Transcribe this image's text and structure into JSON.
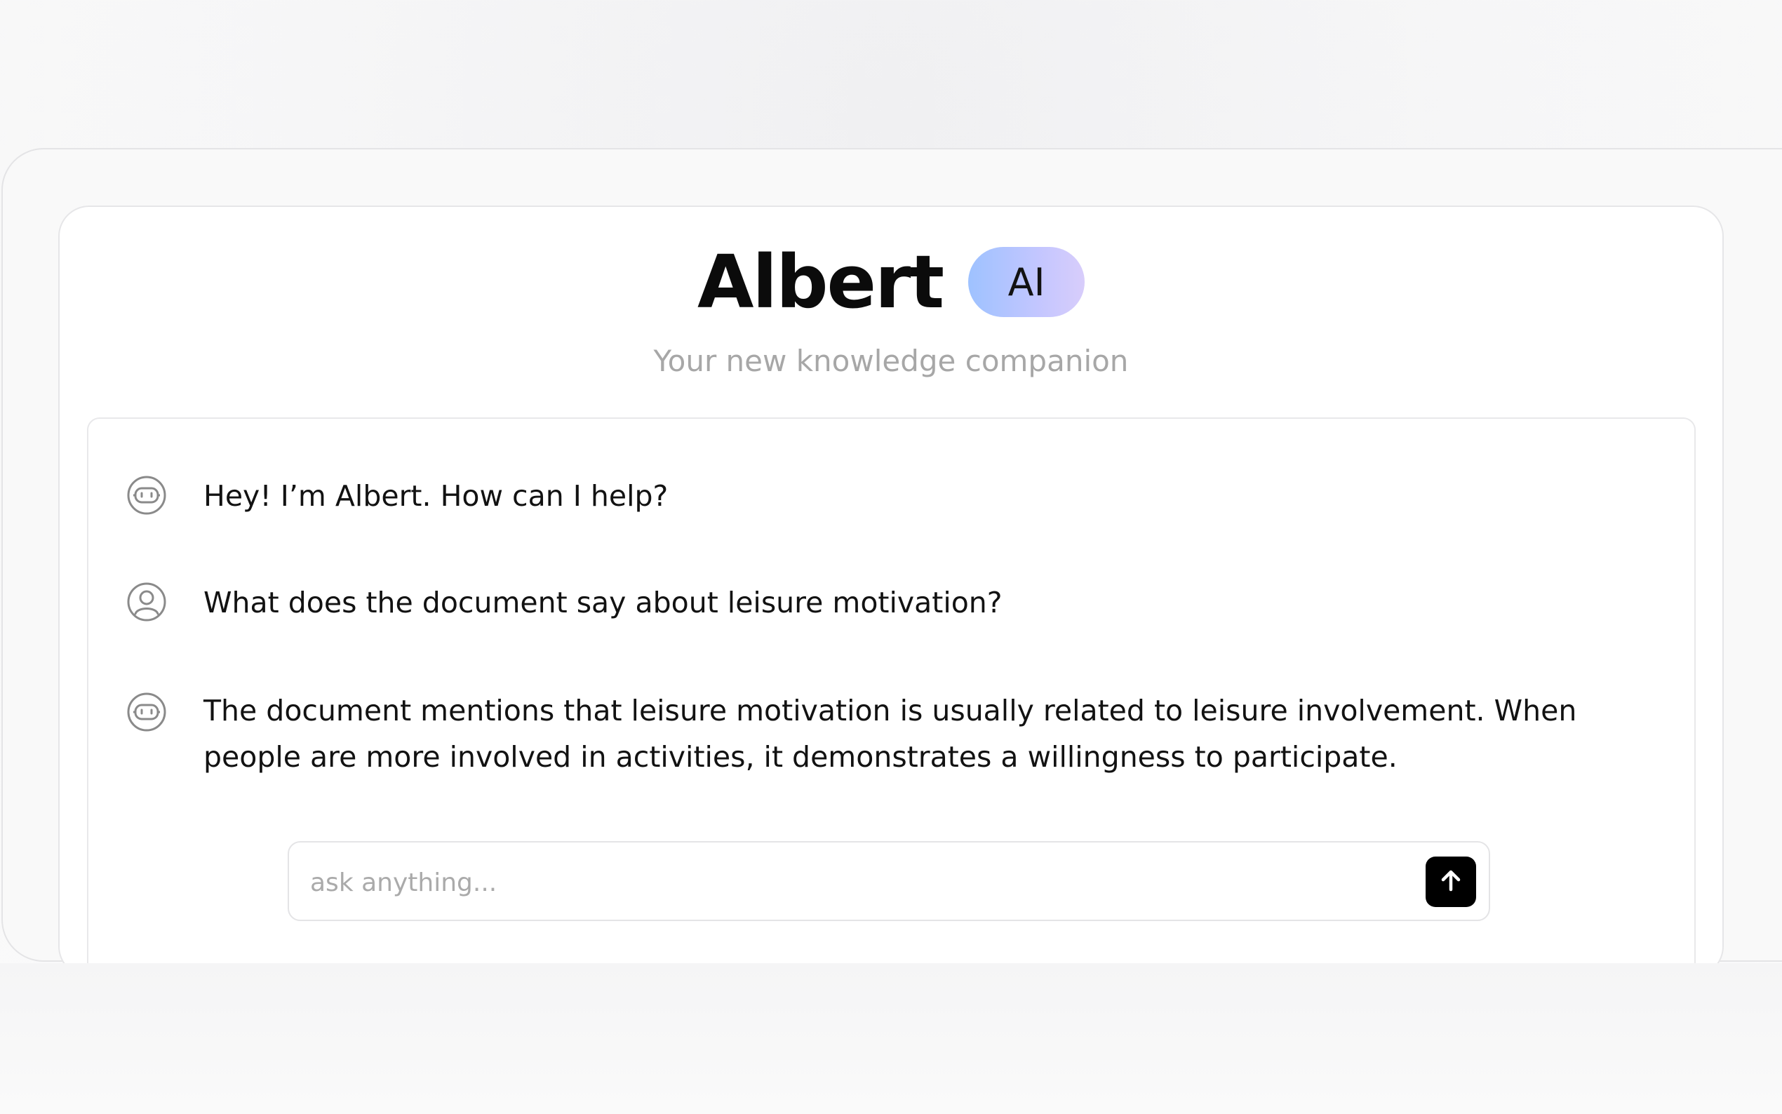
{
  "header": {
    "title": "Albert",
    "badge": "AI",
    "subtitle": "Your new knowledge companion"
  },
  "chat": {
    "messages": [
      {
        "role": "assistant",
        "icon": "robot-face-icon",
        "text": "Hey! I’m Albert. How can I help?"
      },
      {
        "role": "user",
        "icon": "user-avatar-icon",
        "text": "What does the document say about leisure motivation?"
      },
      {
        "role": "assistant",
        "icon": "robot-face-icon",
        "text": "The document mentions that leisure motivation is usually related to leisure involvement. When people are more involved in activities, it demonstrates a willingness to participate."
      }
    ]
  },
  "input": {
    "placeholder": "ask anything...",
    "value": "",
    "send_icon": "arrow-up-icon"
  },
  "colors": {
    "badge_gradient_start": "#9ec2ff",
    "badge_gradient_end": "#d8cdfb",
    "send_button": "#000000",
    "subtitle": "#a7a7a7"
  }
}
